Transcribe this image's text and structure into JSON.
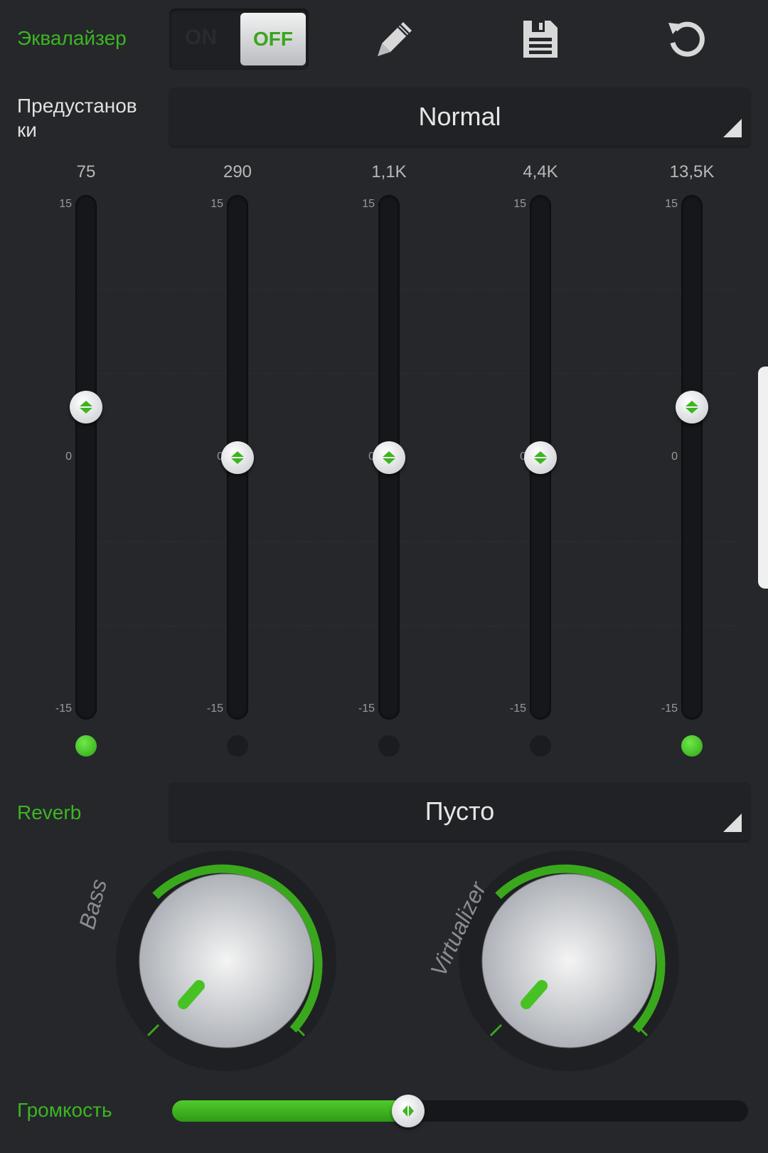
{
  "header": {
    "title": "Эквалайзер",
    "toggle_on": "ON",
    "toggle_off": "OFF",
    "toggle_state": "off",
    "icons": [
      "pencil-icon",
      "save-icon",
      "reset-icon"
    ]
  },
  "preset": {
    "label": "Предустанов ки",
    "value": "Normal"
  },
  "equalizer": {
    "scale": {
      "max": "15",
      "mid": "0",
      "min": "-15"
    },
    "bands": [
      {
        "freq": "75",
        "gain_db": 3,
        "enabled": true
      },
      {
        "freq": "290",
        "gain_db": 0,
        "enabled": false
      },
      {
        "freq": "1,1K",
        "gain_db": 0,
        "enabled": false
      },
      {
        "freq": "4,4K",
        "gain_db": 0,
        "enabled": false
      },
      {
        "freq": "13,5K",
        "gain_db": 3,
        "enabled": true
      }
    ]
  },
  "reverb": {
    "label": "Reverb",
    "value": "Пусто"
  },
  "knobs": [
    {
      "label": "Bass",
      "level": 0
    },
    {
      "label": "Virtualizer",
      "level": 0
    }
  ],
  "volume": {
    "label": "Громкость",
    "level": 0.41
  },
  "colors": {
    "accent": "#3db521",
    "background": "#25272b"
  }
}
